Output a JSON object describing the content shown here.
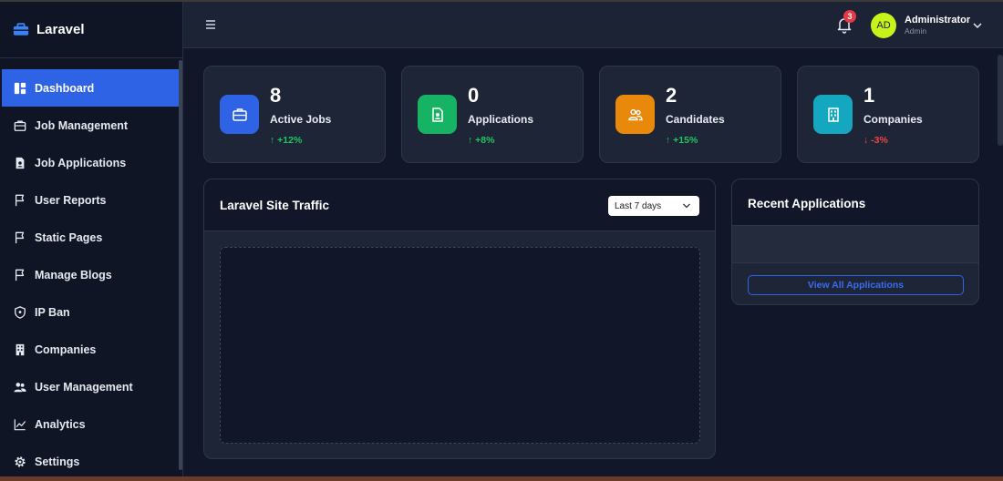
{
  "brand": {
    "title": "Laravel"
  },
  "sidebar": {
    "items": [
      {
        "label": "Dashboard",
        "icon": "dashboard-icon",
        "active": true
      },
      {
        "label": "Job Management",
        "icon": "briefcase-icon"
      },
      {
        "label": "Job Applications",
        "icon": "file-user-icon"
      },
      {
        "label": "User Reports",
        "icon": "flag-icon"
      },
      {
        "label": "Static Pages",
        "icon": "flag-icon"
      },
      {
        "label": "Manage Blogs",
        "icon": "flag-icon"
      },
      {
        "label": "IP Ban",
        "icon": "shield-icon"
      },
      {
        "label": "Companies",
        "icon": "building-icon"
      },
      {
        "label": "User Management",
        "icon": "users-icon"
      },
      {
        "label": "Analytics",
        "icon": "chart-line-icon"
      },
      {
        "label": "Settings",
        "icon": "gear-icon"
      }
    ]
  },
  "topbar": {
    "notifications_count": "3",
    "user": {
      "initials": "AD",
      "name": "Administrator",
      "role": "Admin"
    }
  },
  "stats": [
    {
      "value": "8",
      "label": "Active Jobs",
      "change": "+12%",
      "trend": "up",
      "color": "#2f63e6"
    },
    {
      "value": "0",
      "label": "Applications",
      "change": "+8%",
      "trend": "up",
      "color": "#16b364"
    },
    {
      "value": "2",
      "label": "Candidates",
      "change": "+15%",
      "trend": "up",
      "color": "#e8890c"
    },
    {
      "value": "1",
      "label": "Companies",
      "change": "-3%",
      "trend": "down",
      "color": "#14a7bf"
    }
  ],
  "traffic": {
    "title": "Laravel Site Traffic",
    "range": "Last 7 days"
  },
  "recent": {
    "title": "Recent Applications",
    "view_all": "View All Applications"
  },
  "colors": {
    "accent": "#2f63e6",
    "up": "#22c55e",
    "down": "#ef4444",
    "background": "#111729"
  }
}
